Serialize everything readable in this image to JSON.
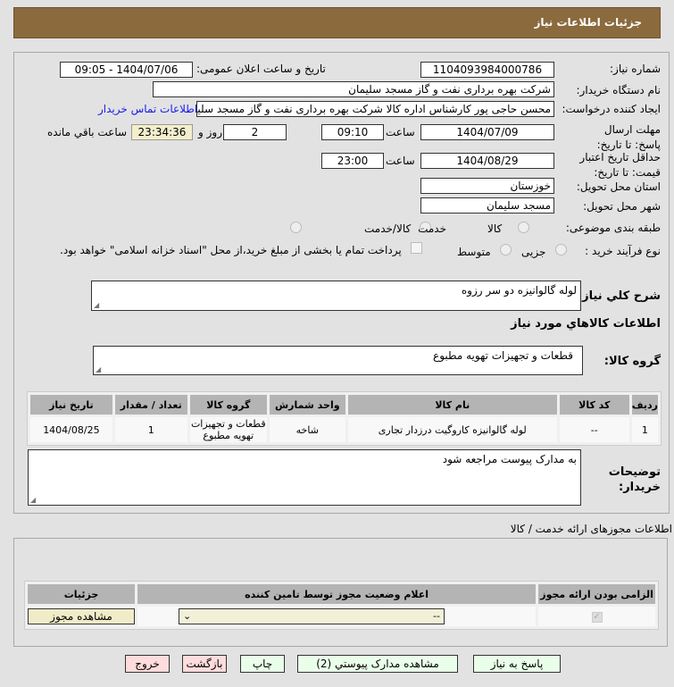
{
  "header": {
    "title": "جزئیات اطلاعات نیاز"
  },
  "form": {
    "need_number_label": "شماره نیاز:",
    "need_number": "1104093984000786",
    "announce_label": "تاریخ و ساعت اعلان عمومی:",
    "announce_value": "1404/07/06 - 09:05",
    "buyer_label": "نام دستگاه خریدار:",
    "buyer_value": "شرکت بهره برداری نفت و گاز مسجد سلیمان",
    "creator_label": "ایجاد کننده درخواست:",
    "creator_value": "محسن حاجی پور کارشناس اداره کالا  شرکت بهره برداری نفت و گاز مسجد سلیمان",
    "contact_link": "اطلاعات تماس خریدار",
    "deadline_label": "مهلت ارسال پاسخ: تا تاریخ:",
    "deadline_date": "1404/07/09",
    "time_label": "ساعت",
    "deadline_time": "09:10",
    "days": "2",
    "days_label": "روز و",
    "remaining": "23:34:36",
    "remaining_label": "ساعت باقي مانده",
    "validity_label": "حداقل تاریخ اعتبار قیمت: تا تاریخ:",
    "validity_date": "1404/08/29",
    "validity_time": "23:00",
    "province_label": "استان محل تحویل:",
    "province": "خوزستان",
    "city_label": "شهر محل تحویل:",
    "city": "مسجد سلیمان",
    "category_label": "طبقه بندی موضوعی:",
    "category_options": [
      "کالا",
      "خدمت",
      "کالا/خدمت"
    ],
    "process_label": "نوع فرآیند خرید :",
    "process_options": [
      "جزیی",
      "متوسط"
    ],
    "payment_note": "پرداخت تمام یا بخشی از مبلغ خرید،از محل \"اسناد خزانه اسلامی\" خواهد بود.",
    "desc_label": "شرح کلي نياز:",
    "desc_value": "لوله گالوانیزه دو سر رزوه",
    "goods_heading": "اطلاعات کالاهاي مورد نياز",
    "group_label": "گروه کالا:",
    "group_value": "قطعات و تجهیزات تهویه مطبوع",
    "notes_label": "توضیحات خریدار:",
    "notes_value": "به مدارک پیوست مراجعه شود"
  },
  "goods_table": {
    "headers": [
      "ردیف",
      "کد کالا",
      "نام کالا",
      "واحد شمارش",
      "گروه کالا",
      "تعداد / مقدار",
      "تاریخ نیاز"
    ],
    "rows": [
      [
        "1",
        "--",
        "لوله گالوانیزه کاروگیت درزدار تجاری",
        "شاخه",
        "قطعات و تجهیزات تهویه مطبوع",
        "1",
        "1404/08/25"
      ]
    ]
  },
  "license": {
    "title": "اطلاعات مجوزهای ارائه خدمت / کالا",
    "headers": [
      "الزامی بودن ارائه مجوز",
      "اعلام وضعیت مجوز توسط تامین کننده",
      "جزئیات"
    ],
    "select_value": "--",
    "view_button": "مشاهده مجوز"
  },
  "buttons": {
    "reply": "پاسخ به نیاز",
    "attachments": "مشاهده مدارک پیوستي (2)",
    "print": "چاپ",
    "back": "بازگشت",
    "exit": "خروج"
  }
}
